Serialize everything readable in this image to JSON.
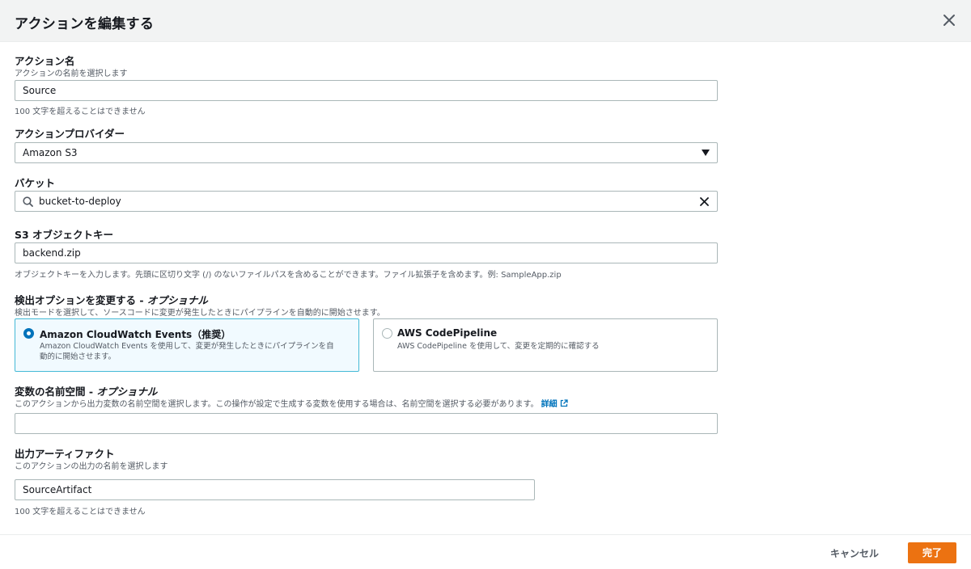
{
  "dialog": {
    "title": "アクションを編集する"
  },
  "action_name": {
    "label": "アクション名",
    "description": "アクションの名前を選択します",
    "value": "Source",
    "hint": "100 文字を超えることはできません"
  },
  "action_provider": {
    "label": "アクションプロバイダー",
    "selected": "Amazon S3"
  },
  "bucket": {
    "label": "バケット",
    "value": "bucket-to-deploy"
  },
  "s3_object_key": {
    "label": "S3 オブジェクトキー",
    "value": "backend.zip",
    "hint": "オブジェクトキーを入力します。先頭に区切り文字 (/) のないファイルパスを含めることができます。ファイル拡張子を含めます。例: SampleApp.zip"
  },
  "detection": {
    "label": "検出オプションを変更する",
    "optional": "オプショナル",
    "description": "検出モードを選択して、ソースコードに変更が発生したときにパイプラインを自動的に開始させます。",
    "options": [
      {
        "title": "Amazon CloudWatch Events（推奨）",
        "desc_line1": "Amazon CloudWatch Events を使用して、変更が発生したときにパイプラインを自",
        "desc_line2": "動的に開始させます。",
        "selected": true
      },
      {
        "title": "AWS CodePipeline",
        "desc_line1": "AWS CodePipeline を使用して、変更を定期的に確認する",
        "selected": false
      }
    ]
  },
  "namespace": {
    "label": "変数の名前空間",
    "optional": "オプショナル",
    "description": "このアクションから出力変数の名前空間を選択します。この操作が設定で生成する変数を使用する場合は、名前空間を選択する必要があります。",
    "link": "詳細",
    "value": ""
  },
  "output_artifact": {
    "label": "出力アーティファクト",
    "description": "このアクションの出力の名前を選択します",
    "value": "SourceArtifact",
    "hint": "100 文字を超えることはできません"
  },
  "footer": {
    "cancel_label": "キャンセル",
    "done_label": "完了"
  },
  "colors": {
    "accent": "#ec7211",
    "link": "#0073bb",
    "selected_border": "#44b9d6"
  }
}
